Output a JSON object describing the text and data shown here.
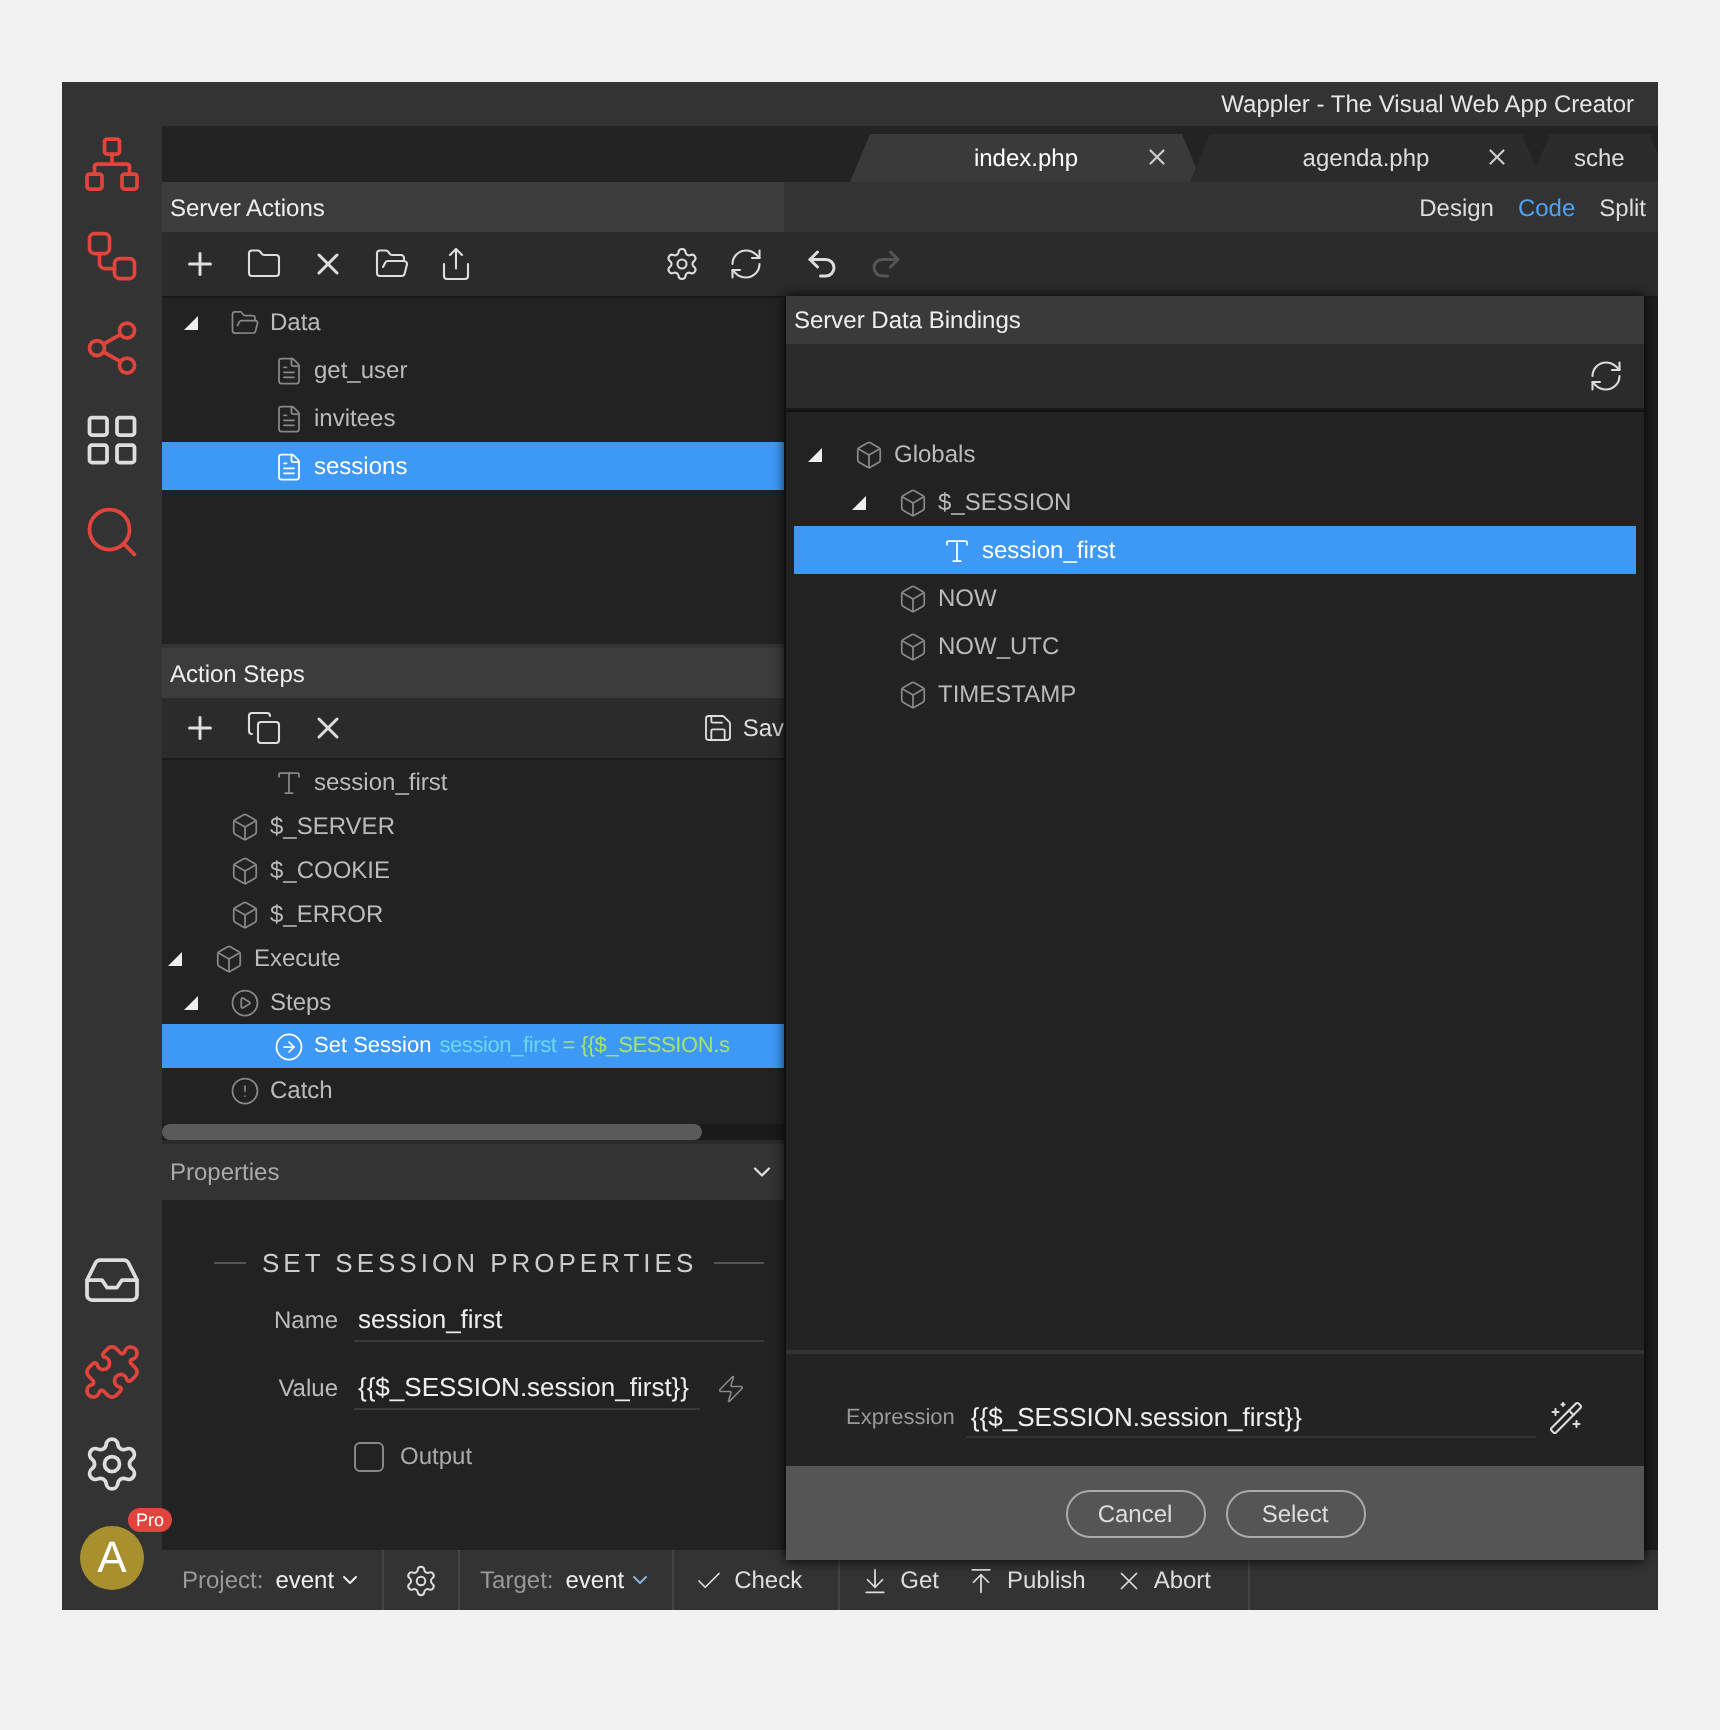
{
  "window": {
    "title": "Wappler - The Visual Web App Creator"
  },
  "user": {
    "initial": "A",
    "badge": "Pro"
  },
  "tabs": [
    {
      "label": "index.php",
      "selected": true,
      "closable": true
    },
    {
      "label": "agenda.php",
      "selected": false,
      "closable": true
    },
    {
      "label": "sche",
      "selected": false,
      "closable": false
    }
  ],
  "view_modes": [
    {
      "label": "Design",
      "selected": false
    },
    {
      "label": "Code",
      "selected": true
    },
    {
      "label": "Split",
      "selected": false
    }
  ],
  "server_actions": {
    "title": "Server Actions",
    "tree": [
      {
        "label": "Data",
        "kind": "folder",
        "expanded": true,
        "selected": false,
        "children": [
          {
            "label": "get_user",
            "kind": "file",
            "selected": false
          },
          {
            "label": "invitees",
            "kind": "file",
            "selected": false
          },
          {
            "label": "sessions",
            "kind": "file",
            "selected": true
          }
        ]
      }
    ]
  },
  "action_steps": {
    "title": "Action Steps",
    "save_label": "Sav",
    "tree": [
      {
        "children": [
          {
            "children": [
              {
                "label": "session_first",
                "kind": "text",
                "selected": false
              }
            ]
          },
          {
            "label": "$_SERVER",
            "kind": "object",
            "selected": false
          },
          {
            "label": "$_COOKIE",
            "kind": "object",
            "selected": false
          },
          {
            "label": "$_ERROR",
            "kind": "object",
            "selected": false
          }
        ]
      },
      {
        "label": "Execute",
        "kind": "object",
        "expanded": true,
        "selected": false,
        "children": [
          {
            "label": "Steps",
            "kind": "steps",
            "expanded": true,
            "selected": false,
            "children": [
              {
                "label": "Set Session",
                "kind": "step",
                "selected": true,
                "detail": "session_first",
                "expression": "= {{$_SESSION.s"
              }
            ]
          },
          {
            "label": "Catch",
            "kind": "catch",
            "selected": false
          }
        ]
      }
    ]
  },
  "properties": {
    "title": "Properties",
    "section": "SET SESSION PROPERTIES",
    "fields": [
      {
        "label": "Name",
        "value": "session_first",
        "binding": false
      },
      {
        "label": "Value",
        "value": "{{$_SESSION.session_first}}",
        "binding": true
      }
    ],
    "checkbox": {
      "label": "Output",
      "checked": false
    }
  },
  "dialog": {
    "title": "Server Data Bindings",
    "tree": [
      {
        "label": "Globals",
        "kind": "object",
        "expanded": true,
        "selected": false,
        "children": [
          {
            "label": "$_SESSION",
            "kind": "object",
            "expanded": true,
            "selected": false,
            "children": [
              {
                "label": "session_first",
                "kind": "text",
                "selected": true
              }
            ]
          },
          {
            "label": "NOW",
            "kind": "object",
            "selected": false
          },
          {
            "label": "NOW_UTC",
            "kind": "object",
            "selected": false
          },
          {
            "label": "TIMESTAMP",
            "kind": "object",
            "selected": false
          }
        ]
      }
    ],
    "expression_label": "Expression",
    "expression": "{{$_SESSION.session_first}}",
    "buttons": [
      "Cancel",
      "Select"
    ]
  },
  "status_bar": {
    "project_label": "Project:",
    "project": "event",
    "target_label": "Target:",
    "target": "event",
    "actions": [
      {
        "kind": "check",
        "label": "Check"
      },
      {
        "kind": "get",
        "label": "Get"
      },
      {
        "kind": "publish",
        "label": "Publish"
      },
      {
        "kind": "abort",
        "label": "Abort"
      }
    ]
  }
}
